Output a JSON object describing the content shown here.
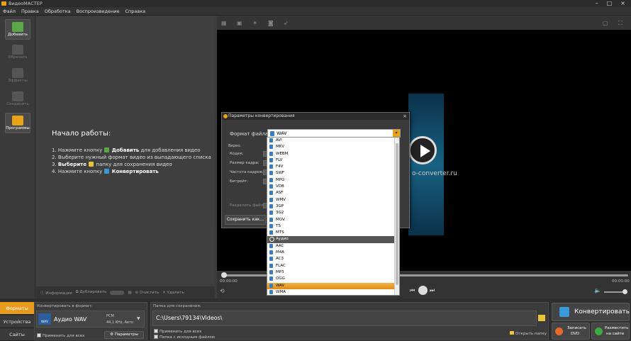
{
  "window": {
    "title": "ВидеоМАСТЕР"
  },
  "menu": [
    "Файл",
    "Правка",
    "Обработка",
    "Воспроизведение",
    "Справка"
  ],
  "toolbar": {
    "add": "Добавить",
    "trim": "Обрезать",
    "effects": "Эффекты",
    "join": "Соединить",
    "programs": "Программы"
  },
  "start": {
    "title": "Начало работы:",
    "step1_prefix": "1. Нажмите кнопку",
    "step1_bold": "Добавить",
    "step1_suffix": "для добавления видео",
    "step2": "2. Выберите нужный формат видео из выпадающего списка",
    "step3_prefix": "3.",
    "step3_bold": "Выберите",
    "step3_suffix": "папку для сохранения видео",
    "step4_prefix": "4. Нажмите кнопку",
    "step4_bold": "Конвертировать"
  },
  "workspace_bar": {
    "info": "Информация",
    "duplicate": "Дублировать",
    "clear": "Очистить",
    "delete": "Удалить"
  },
  "preview": {
    "watermark": "o-converter.ru",
    "time_start": "00:00:00",
    "time_end": "00:00:00"
  },
  "dialog": {
    "title": "Параметры конвертирования",
    "format_label": "Формат файла:",
    "format_value": "WAV",
    "video_group": "Видео:",
    "codec": "Кодек:",
    "frame_size": "Размер кадра:",
    "frame_rate": "Частота кадров:",
    "bitrate": "Битрейт:",
    "split": "Разделить файл:",
    "save_as": "Сохранить как..."
  },
  "dropdown": {
    "items": [
      {
        "label": "AVI",
        "type": "item"
      },
      {
        "label": "MKV",
        "type": "item"
      },
      {
        "label": "WEBM",
        "type": "item"
      },
      {
        "label": "FLV",
        "type": "item"
      },
      {
        "label": "F4V",
        "type": "item"
      },
      {
        "label": "SWF",
        "type": "item"
      },
      {
        "label": "MPG",
        "type": "item"
      },
      {
        "label": "VOB",
        "type": "item"
      },
      {
        "label": "ASF",
        "type": "item"
      },
      {
        "label": "WMV",
        "type": "item"
      },
      {
        "label": "3GP",
        "type": "item"
      },
      {
        "label": "3G2",
        "type": "item"
      },
      {
        "label": "MOV",
        "type": "item"
      },
      {
        "label": "TS",
        "type": "item"
      },
      {
        "label": "MTS",
        "type": "item"
      },
      {
        "label": "Аудио",
        "type": "header"
      },
      {
        "label": "AAC",
        "type": "item"
      },
      {
        "label": "M4A",
        "type": "item"
      },
      {
        "label": "AC3",
        "type": "item"
      },
      {
        "label": "FLAC",
        "type": "item"
      },
      {
        "label": "MP3",
        "type": "item"
      },
      {
        "label": "OGG",
        "type": "item"
      },
      {
        "label": "WAV",
        "type": "selected"
      },
      {
        "label": "WMA",
        "type": "item"
      }
    ]
  },
  "bottom": {
    "tabs": [
      "Форматы",
      "Устройства",
      "Сайты"
    ],
    "convert_to_label": "Конвертировать в формат:",
    "format_name": "Аудио WAV",
    "format_badge": "WAV",
    "codec_info": "PCM",
    "codec_details": "44,1 KHz, Авто",
    "apply_all": "Применить для всех",
    "params": "Параметры",
    "save_folder_label": "Папка для сохранения:",
    "save_path": "C:\\Users\\79134\\Videos\\",
    "apply_all_2": "Применить для всех",
    "source_folder": "Папка с исходным файлом",
    "open_folder": "Открыть папку",
    "convert_btn": "Конвертировать",
    "burn_dvd_1": "Записать",
    "burn_dvd_2": "DVD",
    "publish_1": "Разместить",
    "publish_2": "на сайте"
  }
}
